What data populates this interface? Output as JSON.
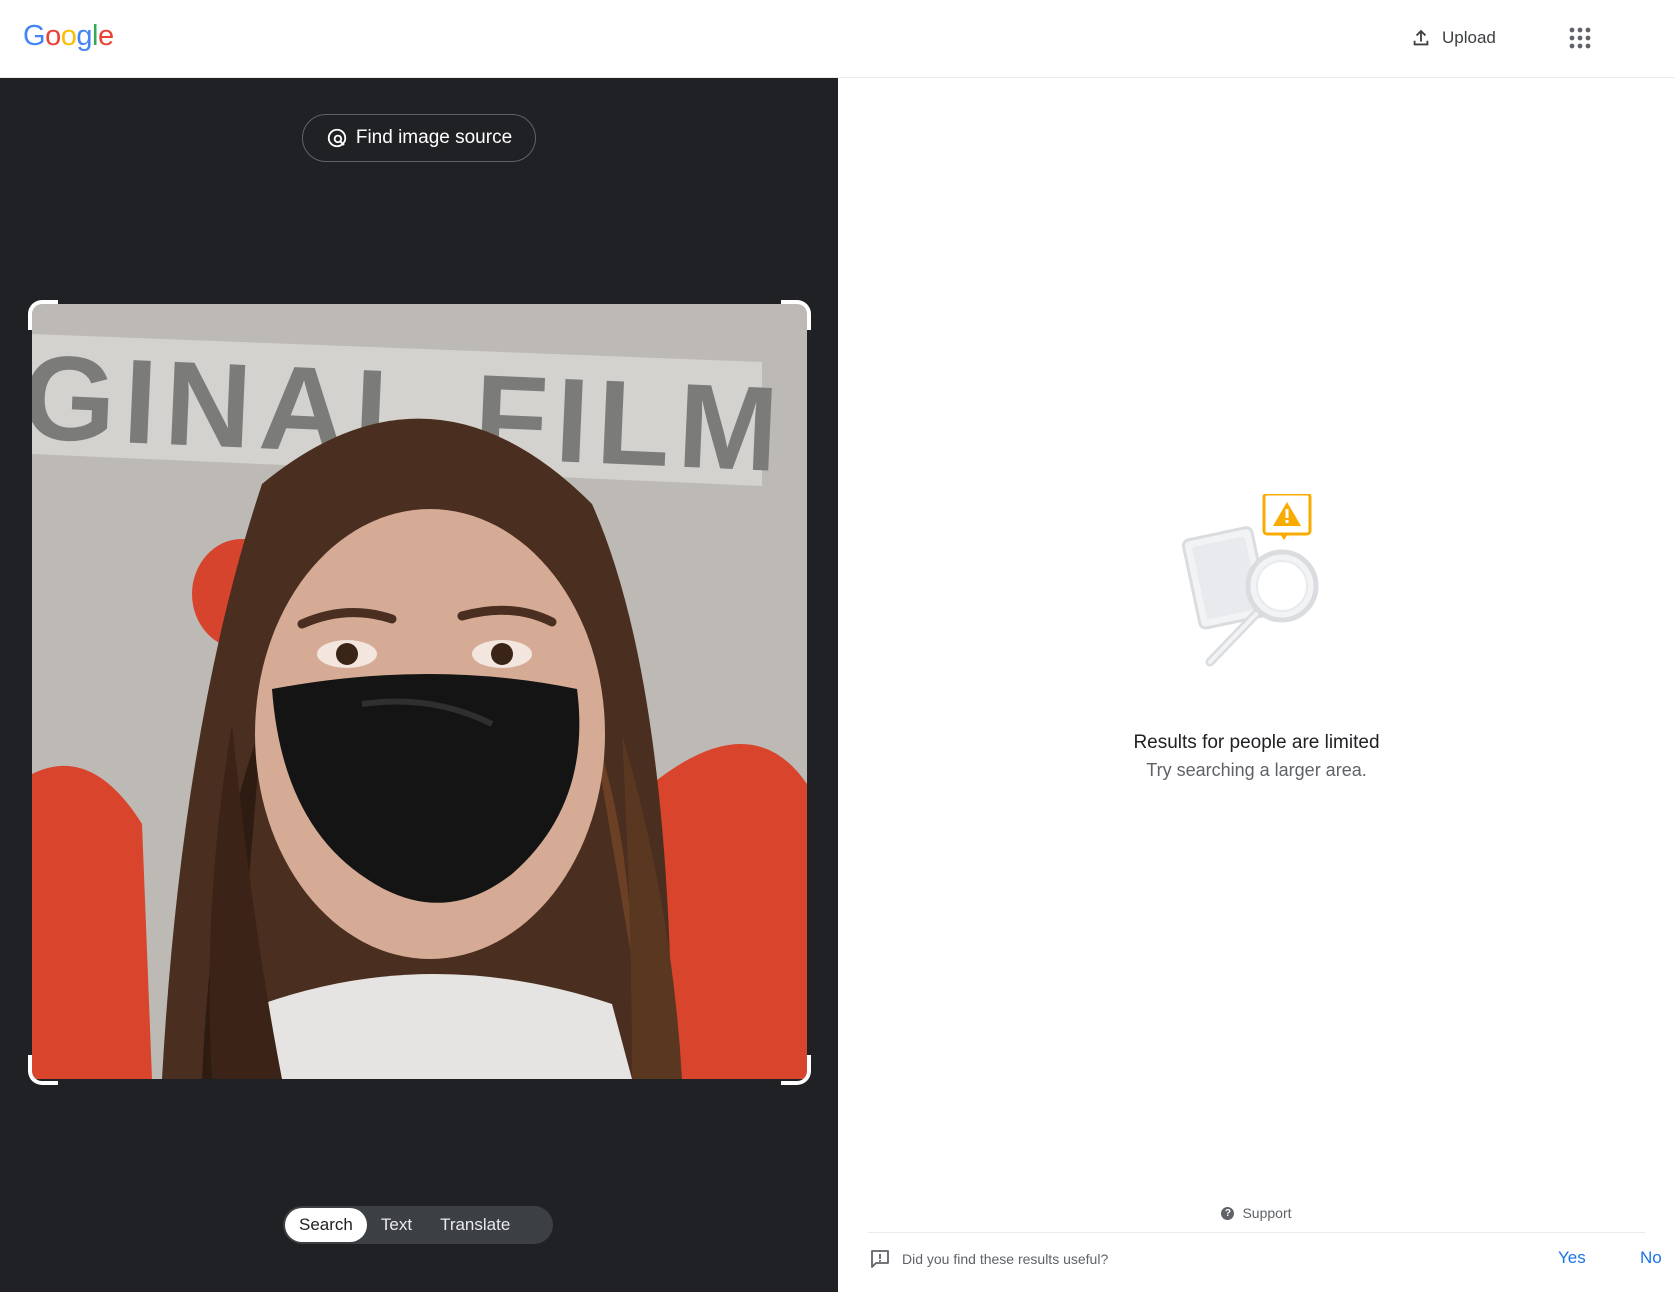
{
  "header": {
    "logo_letters": [
      "G",
      "o",
      "o",
      "g",
      "l",
      "e"
    ],
    "upload_label": "Upload"
  },
  "left": {
    "find_source_label": "Find image source",
    "modes": [
      {
        "label": "Search",
        "active": true
      },
      {
        "label": "Text",
        "active": false
      },
      {
        "label": "Translate",
        "active": false
      }
    ],
    "image_visible_text": "GINAL FILM"
  },
  "right": {
    "title": "Results for people are limited",
    "subtitle": "Try searching a larger area.",
    "support_label": "Support",
    "feedback_question": "Did you find these results useful?",
    "feedback_yes": "Yes",
    "feedback_no": "No"
  },
  "colors": {
    "google_blue": "#4285F4",
    "google_red": "#EA4335",
    "google_yellow": "#FBBC05",
    "google_green": "#34A853",
    "dark_panel": "#202124",
    "link_blue": "#1a73e8",
    "warning_yellow": "#F9AB00"
  }
}
